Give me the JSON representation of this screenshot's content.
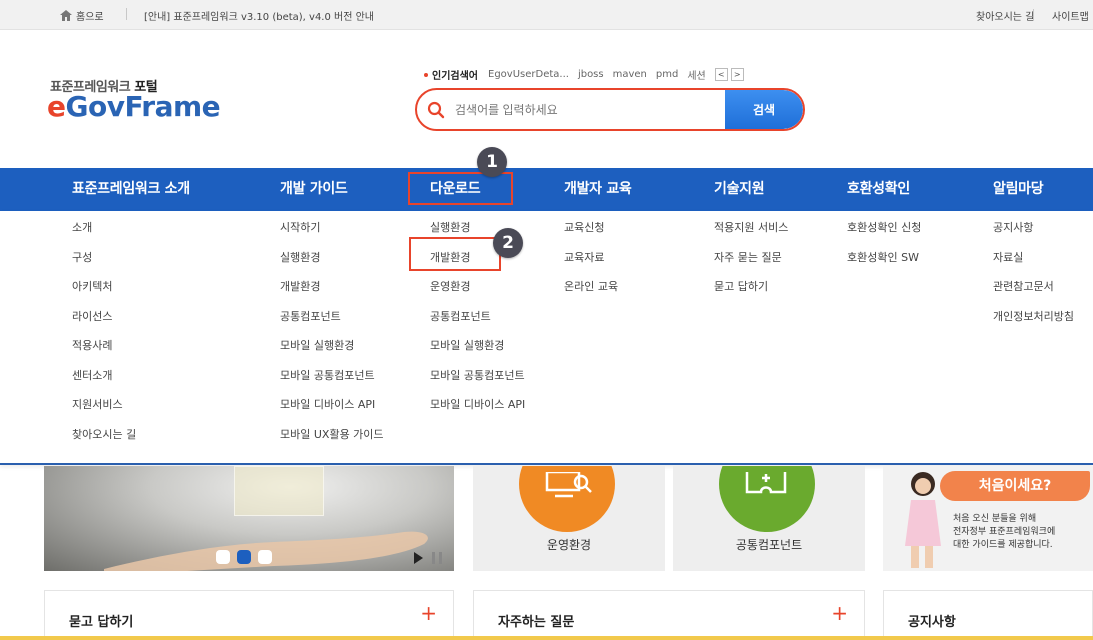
{
  "topbar": {
    "home_label": "홈으로",
    "notice": "[안내] 표준프레임워크 v3.10 (beta), v4.0 버전 안내",
    "directions": "찾아오시는 길",
    "sitemap": "사이트맵"
  },
  "logo": {
    "sub_prefix": "표준프레임워크",
    "sub_bold": "포털",
    "main_e": "e",
    "main_rest": "GovFrame"
  },
  "popular": {
    "label": "인기검색어",
    "keywords": [
      "EgovUserDeta...",
      "jboss",
      "maven",
      "pmd",
      "세션"
    ],
    "prev": "<",
    "next": ">"
  },
  "search": {
    "placeholder": "검색어를 입력하세요",
    "button": "검색"
  },
  "nav": [
    {
      "label": "표준프레임워크 소개",
      "items": [
        "소개",
        "구성",
        "아키텍처",
        "라이선스",
        "적용사례",
        "센터소개",
        "지원서비스",
        "찾아오시는 길"
      ]
    },
    {
      "label": "개발 가이드",
      "items": [
        "시작하기",
        "실행환경",
        "개발환경",
        "공통컴포넌트",
        "모바일 실행환경",
        "모바일 공통컴포넌트",
        "모바일 디바이스 API",
        "모바일 UX활용 가이드"
      ]
    },
    {
      "label": "다운로드",
      "items": [
        "실행환경",
        "개발환경",
        "운영환경",
        "공통컴포넌트",
        "모바일 실행환경",
        "모바일 공통컴포넌트",
        "모바일 디바이스 API"
      ]
    },
    {
      "label": "개발자 교육",
      "items": [
        "교육신청",
        "교육자료",
        "온라인 교육"
      ]
    },
    {
      "label": "기술지원",
      "items": [
        "적용지원 서비스",
        "자주 묻는 질문",
        "묻고 답하기"
      ]
    },
    {
      "label": "호환성확인",
      "items": [
        "호환성확인 신청",
        "호환성확인 SW"
      ]
    },
    {
      "label": "알림마당",
      "items": [
        "공지사항",
        "자료실",
        "관련참고문서",
        "개인정보처리방침"
      ]
    }
  ],
  "annotations": {
    "badge1": "1",
    "badge2": "2"
  },
  "cards": [
    {
      "label": "운영환경",
      "color": "#f08a24"
    },
    {
      "label": "공통컴포넌트",
      "color": "#6aaa2e"
    }
  ],
  "first_visit": {
    "title": "처음이세요?",
    "line1": "처음 오신 분들을 위해",
    "line2": "전자정부 표준프레임워크에",
    "line3": "대한 가이드를 제공합니다."
  },
  "boxes": [
    "묻고 답하기",
    "자주하는 질문",
    "공지사항"
  ],
  "colors": {
    "accent": "#e8442b",
    "nav_blue": "#1d5fbf",
    "logo_blue": "#2a64b4"
  }
}
